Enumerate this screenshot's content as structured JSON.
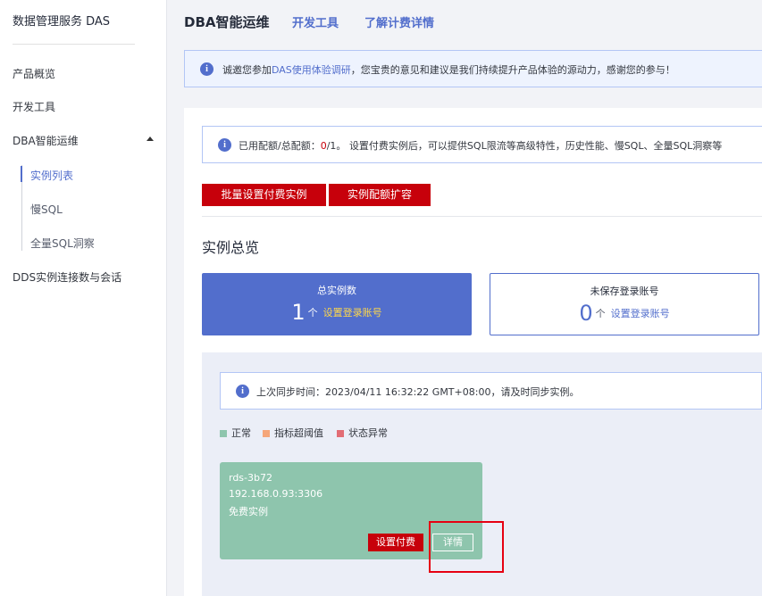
{
  "sidebar": {
    "title": "数据管理服务 DAS",
    "items": [
      {
        "label": "产品概览"
      },
      {
        "label": "开发工具"
      },
      {
        "label": "DBA智能运维"
      },
      {
        "label": "DDS实例连接数与会话"
      }
    ],
    "subitems": [
      {
        "label": "实例列表",
        "active": true
      },
      {
        "label": "慢SQL"
      },
      {
        "label": "全量SQL洞察"
      }
    ]
  },
  "header": {
    "title": "DBA智能运维",
    "links": [
      "开发工具",
      "了解计费详情"
    ]
  },
  "notice": {
    "prefix": "诚邀您参加",
    "link": "DAS使用体验调研",
    "suffix": "，您宝贵的意见和建议是我们持续提升产品体验的源动力，感谢您的参与！"
  },
  "quota": {
    "prefix": "已用配额/总配额：",
    "used": "0",
    "total": "/1。",
    "suffix": "设置付费实例后，可以提供SQL限流等高级特性，历史性能、慢SQL、全量SQL洞察等"
  },
  "buttons": {
    "batch": "批量设置付费实例",
    "expand": "实例配额扩容"
  },
  "overview": {
    "title": "实例总览",
    "total_label": "总实例数",
    "total_value": "1",
    "unsaved_label": "未保存登录账号",
    "unsaved_value": "0",
    "unit": "个",
    "set_login_link": "设置登录账号"
  },
  "sync": {
    "text": "上次同步时间：2023/04/11 16:32:22 GMT+08:00，请及时同步实例。"
  },
  "legend": [
    {
      "label": "正常",
      "color": "#8ec5ad"
    },
    {
      "label": "指标超阈值",
      "color": "#f5a67a"
    },
    {
      "label": "状态异常",
      "color": "#e26d75"
    }
  ],
  "instance": {
    "name": "rds-3b72",
    "address": "192.168.0.93:3306",
    "type": "免费实例",
    "set_paid": "设置付费",
    "detail": "详情"
  },
  "colors": {
    "accent": "#526ecc",
    "danger": "#c7000b",
    "normal": "#8ec5ad"
  }
}
